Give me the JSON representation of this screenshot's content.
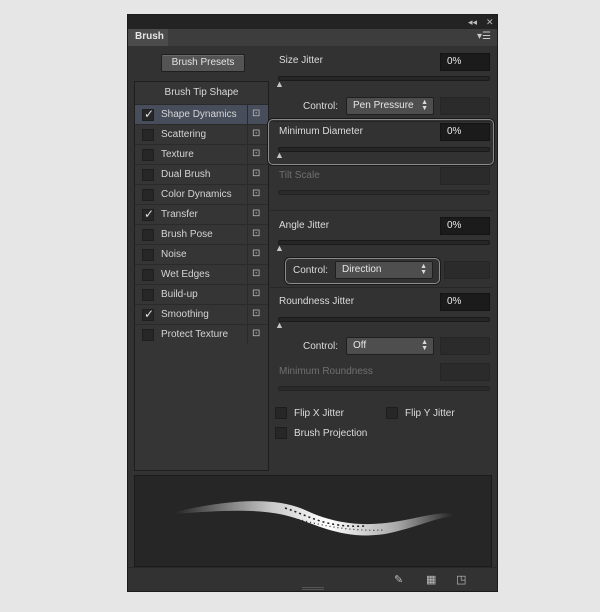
{
  "window": {
    "collapse_glyph": "◂◂",
    "close_glyph": "✕",
    "tab_label": "Brush",
    "menu_glyph": "▾☰"
  },
  "left": {
    "presets_button": "Brush Presets",
    "header": "Brush Tip Shape",
    "items": [
      {
        "label": "Shape Dynamics",
        "checked": true,
        "selected": true
      },
      {
        "label": "Scattering",
        "checked": false
      },
      {
        "label": "Texture",
        "checked": false
      },
      {
        "label": "Dual Brush",
        "checked": false
      },
      {
        "label": "Color Dynamics",
        "checked": false
      },
      {
        "label": "Transfer",
        "checked": true
      },
      {
        "label": "Brush Pose",
        "checked": false
      },
      {
        "label": "Noise",
        "checked": false
      },
      {
        "label": "Wet Edges",
        "checked": false
      },
      {
        "label": "Build-up",
        "checked": false
      },
      {
        "label": "Smoothing",
        "checked": true
      },
      {
        "label": "Protect Texture",
        "checked": false
      }
    ]
  },
  "right": {
    "size_jitter": {
      "label": "Size Jitter",
      "value": "0%"
    },
    "control1": {
      "label": "Control:",
      "value": "Pen Pressure"
    },
    "min_diameter": {
      "label": "Minimum Diameter",
      "value": "0%"
    },
    "tilt_scale": {
      "label": "Tilt Scale"
    },
    "angle_jitter": {
      "label": "Angle Jitter",
      "value": "0%"
    },
    "control2": {
      "label": "Control:",
      "value": "Direction"
    },
    "roundness_jitter": {
      "label": "Roundness Jitter",
      "value": "0%"
    },
    "control3": {
      "label": "Control:",
      "value": "Off"
    },
    "min_roundness": {
      "label": "Minimum Roundness"
    },
    "flip_x": {
      "label": "Flip X Jitter"
    },
    "flip_y": {
      "label": "Flip Y Jitter"
    },
    "brush_projection": {
      "label": "Brush Projection"
    }
  },
  "icons": {
    "check": "✓",
    "lock": "🔒",
    "knob": "▲",
    "dropdown": "◆"
  },
  "colors": {
    "panel_bg": "#323232",
    "selected_row": "#474d5a",
    "field_bg": "#1b1b1b"
  }
}
